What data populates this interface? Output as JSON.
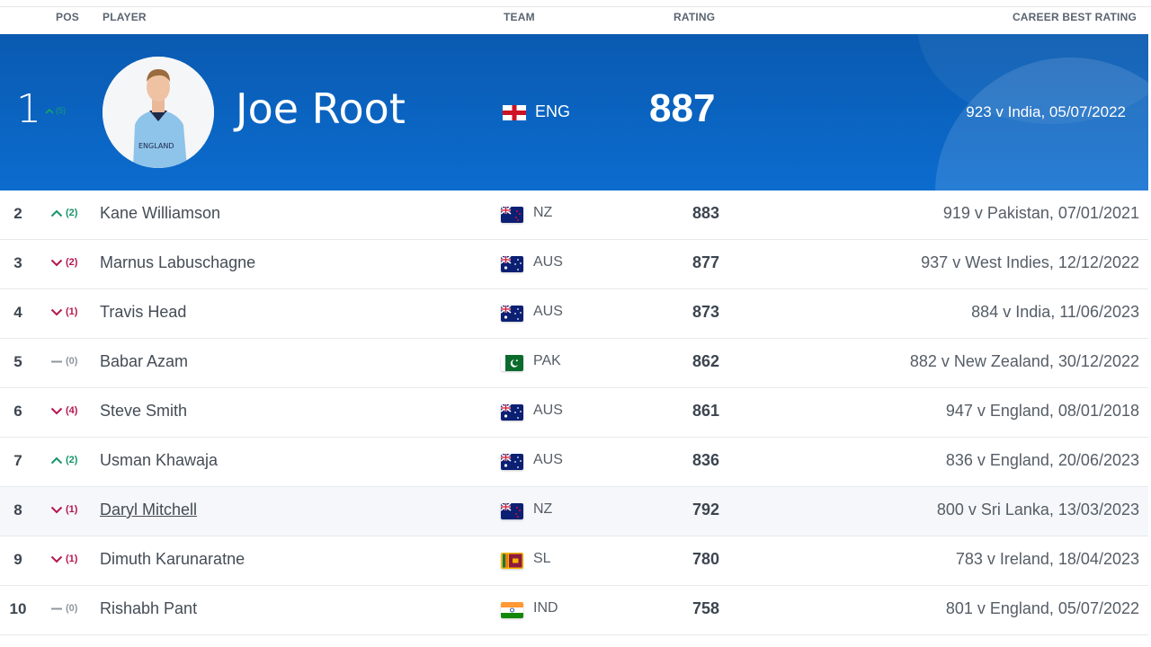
{
  "header": {
    "pos": "POS",
    "player": "PLAYER",
    "team": "TEAM",
    "rating": "RATING",
    "career_best": "CAREER BEST RATING"
  },
  "colors": {
    "hero_blue": "#0b6ccf",
    "up": "#17936a",
    "down": "#b5154f",
    "same": "#8f979f"
  },
  "leader": {
    "pos": "1",
    "move_dir": "up",
    "move_icon": "chevron-up-icon",
    "move_count": "(5)",
    "name": "Joe Root",
    "team": "ENG",
    "flag": "england-flag-icon",
    "rating": "887",
    "career_best": "923 v India, 05/07/2022"
  },
  "rows": [
    {
      "pos": "2",
      "move_dir": "up",
      "move_count": "(2)",
      "name": "Kane Williamson",
      "team": "NZ",
      "flag": "nz",
      "rating": "883",
      "career_best": "919 v Pakistan, 07/01/2021"
    },
    {
      "pos": "3",
      "move_dir": "down",
      "move_count": "(2)",
      "name": "Marnus Labuschagne",
      "team": "AUS",
      "flag": "aus",
      "rating": "877",
      "career_best": "937 v West Indies, 12/12/2022"
    },
    {
      "pos": "4",
      "move_dir": "down",
      "move_count": "(1)",
      "name": "Travis Head",
      "team": "AUS",
      "flag": "aus",
      "rating": "873",
      "career_best": "884 v India, 11/06/2023"
    },
    {
      "pos": "5",
      "move_dir": "same",
      "move_count": "(0)",
      "name": "Babar Azam",
      "team": "PAK",
      "flag": "pak",
      "rating": "862",
      "career_best": "882 v New Zealand, 30/12/2022"
    },
    {
      "pos": "6",
      "move_dir": "down",
      "move_count": "(4)",
      "name": "Steve Smith",
      "team": "AUS",
      "flag": "aus",
      "rating": "861",
      "career_best": "947 v England, 08/01/2018"
    },
    {
      "pos": "7",
      "move_dir": "up",
      "move_count": "(2)",
      "name": "Usman Khawaja",
      "team": "AUS",
      "flag": "aus",
      "rating": "836",
      "career_best": "836 v England, 20/06/2023"
    },
    {
      "pos": "8",
      "move_dir": "down",
      "move_count": "(1)",
      "name": "Daryl Mitchell",
      "team": "NZ",
      "flag": "nz",
      "rating": "792",
      "career_best": "800 v Sri Lanka, 13/03/2023",
      "hovered": true
    },
    {
      "pos": "9",
      "move_dir": "down",
      "move_count": "(1)",
      "name": "Dimuth Karunaratne",
      "team": "SL",
      "flag": "sl",
      "rating": "780",
      "career_best": "783 v Ireland, 18/04/2023"
    },
    {
      "pos": "10",
      "move_dir": "same",
      "move_count": "(0)",
      "name": "Rishabh Pant",
      "team": "IND",
      "flag": "ind",
      "rating": "758",
      "career_best": "801 v England, 05/07/2022"
    }
  ]
}
